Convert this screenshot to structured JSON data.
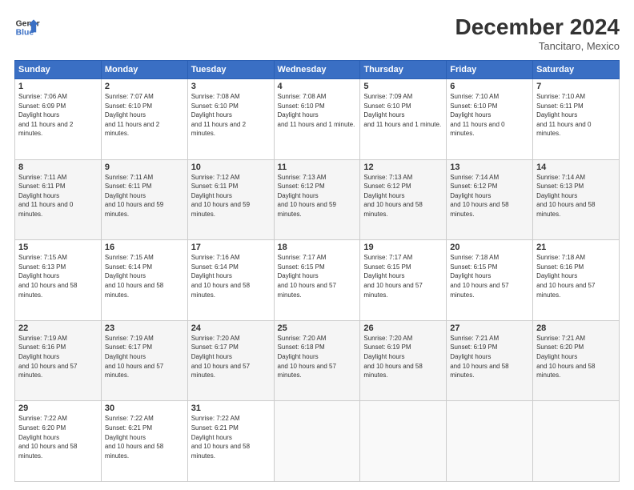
{
  "header": {
    "logo_line1": "General",
    "logo_line2": "Blue",
    "title": "December 2024",
    "subtitle": "Tancitaro, Mexico"
  },
  "weekdays": [
    "Sunday",
    "Monday",
    "Tuesday",
    "Wednesday",
    "Thursday",
    "Friday",
    "Saturday"
  ],
  "weeks": [
    [
      {
        "day": "1",
        "sunrise": "7:06 AM",
        "sunset": "6:09 PM",
        "daylight": "11 hours and 2 minutes."
      },
      {
        "day": "2",
        "sunrise": "7:07 AM",
        "sunset": "6:10 PM",
        "daylight": "11 hours and 2 minutes."
      },
      {
        "day": "3",
        "sunrise": "7:08 AM",
        "sunset": "6:10 PM",
        "daylight": "11 hours and 2 minutes."
      },
      {
        "day": "4",
        "sunrise": "7:08 AM",
        "sunset": "6:10 PM",
        "daylight": "11 hours and 1 minute."
      },
      {
        "day": "5",
        "sunrise": "7:09 AM",
        "sunset": "6:10 PM",
        "daylight": "11 hours and 1 minute."
      },
      {
        "day": "6",
        "sunrise": "7:10 AM",
        "sunset": "6:10 PM",
        "daylight": "11 hours and 0 minutes."
      },
      {
        "day": "7",
        "sunrise": "7:10 AM",
        "sunset": "6:11 PM",
        "daylight": "11 hours and 0 minutes."
      }
    ],
    [
      {
        "day": "8",
        "sunrise": "7:11 AM",
        "sunset": "6:11 PM",
        "daylight": "11 hours and 0 minutes."
      },
      {
        "day": "9",
        "sunrise": "7:11 AM",
        "sunset": "6:11 PM",
        "daylight": "10 hours and 59 minutes."
      },
      {
        "day": "10",
        "sunrise": "7:12 AM",
        "sunset": "6:11 PM",
        "daylight": "10 hours and 59 minutes."
      },
      {
        "day": "11",
        "sunrise": "7:13 AM",
        "sunset": "6:12 PM",
        "daylight": "10 hours and 59 minutes."
      },
      {
        "day": "12",
        "sunrise": "7:13 AM",
        "sunset": "6:12 PM",
        "daylight": "10 hours and 58 minutes."
      },
      {
        "day": "13",
        "sunrise": "7:14 AM",
        "sunset": "6:12 PM",
        "daylight": "10 hours and 58 minutes."
      },
      {
        "day": "14",
        "sunrise": "7:14 AM",
        "sunset": "6:13 PM",
        "daylight": "10 hours and 58 minutes."
      }
    ],
    [
      {
        "day": "15",
        "sunrise": "7:15 AM",
        "sunset": "6:13 PM",
        "daylight": "10 hours and 58 minutes."
      },
      {
        "day": "16",
        "sunrise": "7:15 AM",
        "sunset": "6:14 PM",
        "daylight": "10 hours and 58 minutes."
      },
      {
        "day": "17",
        "sunrise": "7:16 AM",
        "sunset": "6:14 PM",
        "daylight": "10 hours and 58 minutes."
      },
      {
        "day": "18",
        "sunrise": "7:17 AM",
        "sunset": "6:15 PM",
        "daylight": "10 hours and 57 minutes."
      },
      {
        "day": "19",
        "sunrise": "7:17 AM",
        "sunset": "6:15 PM",
        "daylight": "10 hours and 57 minutes."
      },
      {
        "day": "20",
        "sunrise": "7:18 AM",
        "sunset": "6:15 PM",
        "daylight": "10 hours and 57 minutes."
      },
      {
        "day": "21",
        "sunrise": "7:18 AM",
        "sunset": "6:16 PM",
        "daylight": "10 hours and 57 minutes."
      }
    ],
    [
      {
        "day": "22",
        "sunrise": "7:19 AM",
        "sunset": "6:16 PM",
        "daylight": "10 hours and 57 minutes."
      },
      {
        "day": "23",
        "sunrise": "7:19 AM",
        "sunset": "6:17 PM",
        "daylight": "10 hours and 57 minutes."
      },
      {
        "day": "24",
        "sunrise": "7:20 AM",
        "sunset": "6:17 PM",
        "daylight": "10 hours and 57 minutes."
      },
      {
        "day": "25",
        "sunrise": "7:20 AM",
        "sunset": "6:18 PM",
        "daylight": "10 hours and 57 minutes."
      },
      {
        "day": "26",
        "sunrise": "7:20 AM",
        "sunset": "6:19 PM",
        "daylight": "10 hours and 58 minutes."
      },
      {
        "day": "27",
        "sunrise": "7:21 AM",
        "sunset": "6:19 PM",
        "daylight": "10 hours and 58 minutes."
      },
      {
        "day": "28",
        "sunrise": "7:21 AM",
        "sunset": "6:20 PM",
        "daylight": "10 hours and 58 minutes."
      }
    ],
    [
      {
        "day": "29",
        "sunrise": "7:22 AM",
        "sunset": "6:20 PM",
        "daylight": "10 hours and 58 minutes."
      },
      {
        "day": "30",
        "sunrise": "7:22 AM",
        "sunset": "6:21 PM",
        "daylight": "10 hours and 58 minutes."
      },
      {
        "day": "31",
        "sunrise": "7:22 AM",
        "sunset": "6:21 PM",
        "daylight": "10 hours and 58 minutes."
      },
      null,
      null,
      null,
      null
    ]
  ]
}
